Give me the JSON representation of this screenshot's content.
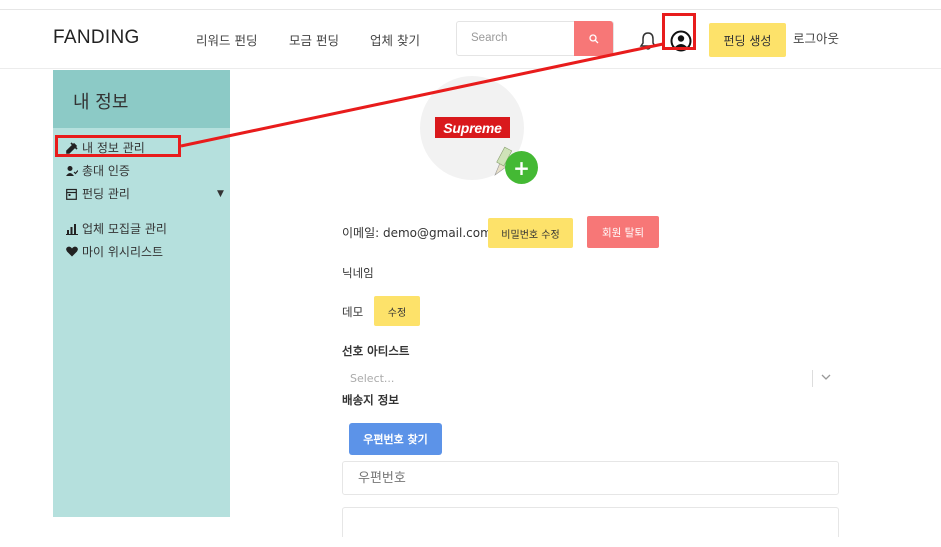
{
  "header": {
    "logo": "FANDING",
    "nav": [
      "리워드 펀딩",
      "모금 펀딩",
      "업체 찾기"
    ],
    "search_placeholder": "Search",
    "create_funding_label": "펀딩 생성",
    "logout_label": "로그아웃"
  },
  "sidebar": {
    "title": "내 정보",
    "items": [
      {
        "label": "내 정보 관리",
        "icon": "tools-icon"
      },
      {
        "label": "총대 인증",
        "icon": "user-check-icon"
      },
      {
        "label": "펀딩 관리",
        "icon": "calendar-icon",
        "has_dropdown": true
      },
      {
        "label": "업체 모집글 관리",
        "icon": "chart-icon"
      },
      {
        "label": "마이 위시리스트",
        "icon": "heart-icon"
      }
    ]
  },
  "profile": {
    "brand_badge": "Supreme",
    "add_button": "+",
    "email_text": "이메일: demo@gmail.com",
    "change_password_label": "비밀번호 수정",
    "withdraw_label": "회원 탈퇴",
    "nickname_label": "닉네임",
    "nickname_value": "데모",
    "edit_label": "수정",
    "artist_label": "선호 아티스트",
    "artist_placeholder": "Select...",
    "shipping_label": "배송지 정보",
    "find_zip_label": "우편번호 찾기",
    "zip_placeholder": "우편번호"
  },
  "colors": {
    "sidebar_bg": "#b5e0dd",
    "sidebar_head_bg": "#8ccac6",
    "yellow_button": "#fde26a",
    "red_button": "#f77777",
    "blue_button": "#5c93e8",
    "highlight_red": "#e81c1c",
    "plus_green": "#44b934"
  }
}
